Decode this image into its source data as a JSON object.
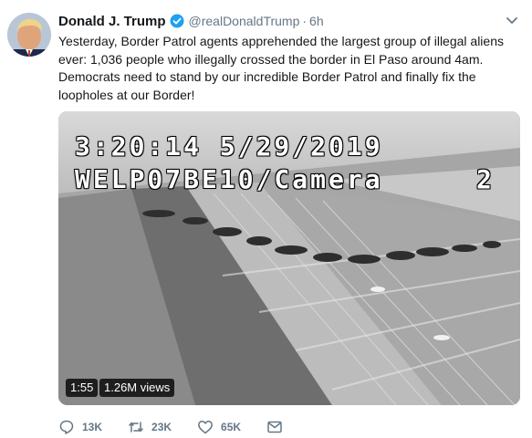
{
  "author": {
    "name": "Donald J. Trump",
    "handle": "@realDonaldTrump",
    "separator": "·",
    "time": "6h",
    "verified_color": "#1da1f2"
  },
  "tweet": {
    "text_lines": [
      "Yesterday, Border Patrol agents apprehended the largest group of illegal aliens",
      "ever: 1,036 people who illegally crossed the border in El Paso around 4am.",
      "Democrats need to stand by our incredible Border Patrol and finally fix the",
      "loopholes at our Border!"
    ]
  },
  "video": {
    "timestamp_line": "3:20:14 5/29/2019",
    "camera_line": "WELP07BE10/Camera",
    "camera_number": "2",
    "duration": "1:55",
    "views": "1.26M views"
  },
  "actions": {
    "reply_count": "13K",
    "retweet_count": "23K",
    "like_count": "65K",
    "icon_color": "#657786"
  }
}
